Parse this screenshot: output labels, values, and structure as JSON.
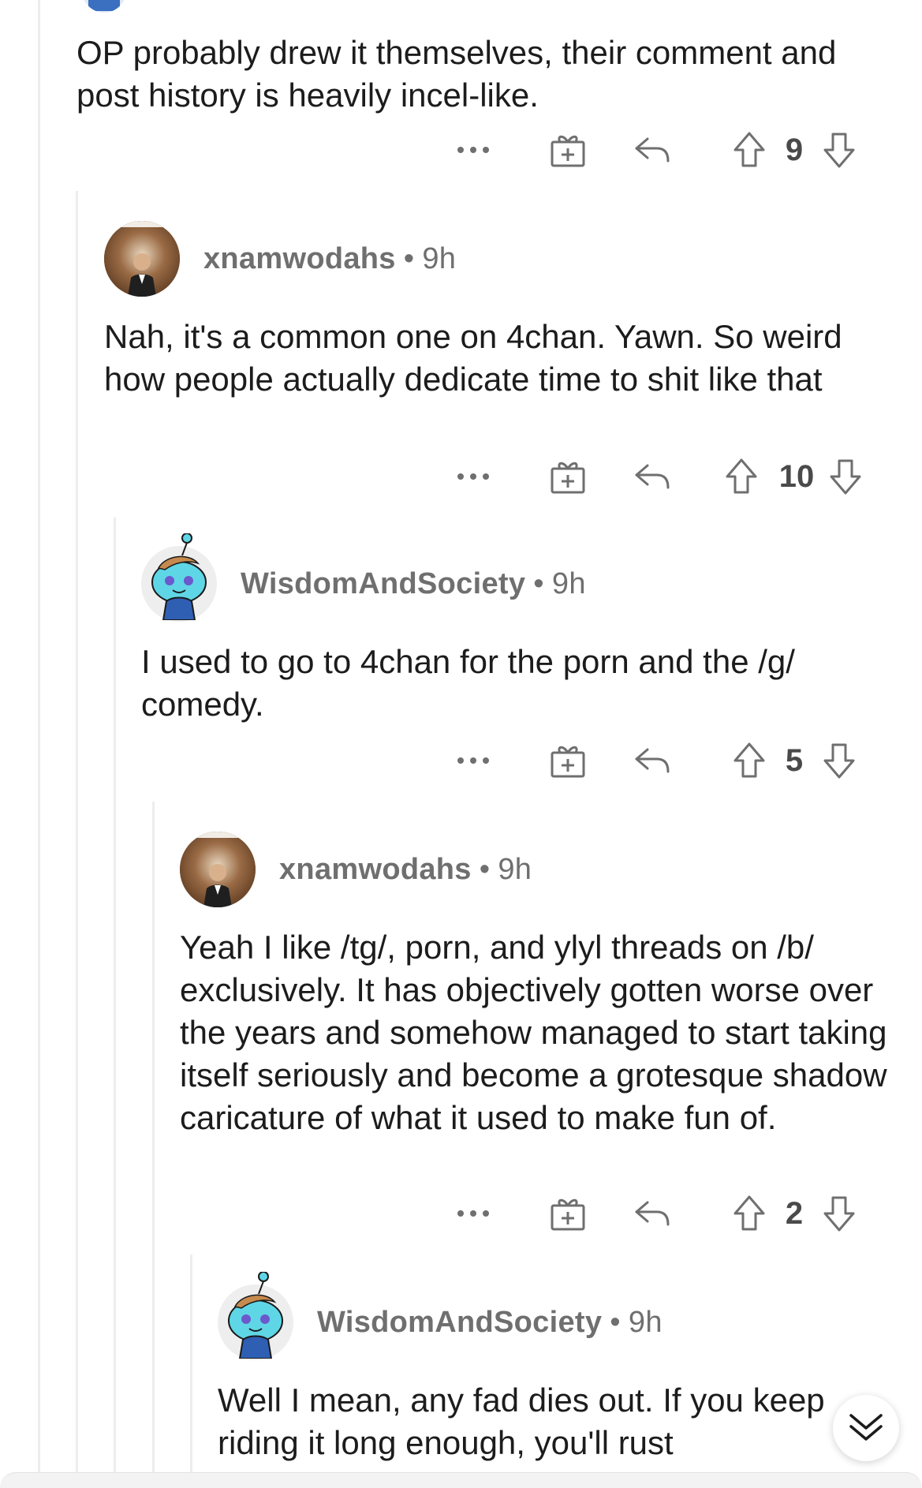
{
  "colors": {
    "text": "#1c1c1c",
    "meta": "#6f6f6f",
    "icon": "#6f6f6f",
    "thread_line": "#ededed"
  },
  "top_comment": {
    "text": "OP probably drew it themselves, their comment and post history is heavily incel-like.",
    "score": "9"
  },
  "comments": [
    {
      "username": "xnamwodahs",
      "separator": "•",
      "time": "9h",
      "avatar": "photo-avatar",
      "text": "Nah, it's a common one on 4chan. Yawn. So weird how people actually dedicate time to shit like that",
      "score": "10"
    },
    {
      "username": "WisdomAndSociety",
      "separator": "•",
      "time": "9h",
      "avatar": "snoo-avatar",
      "text": "I used to go to 4chan for the porn and the /g/ comedy.",
      "score": "5"
    },
    {
      "username": "xnamwodahs",
      "separator": "•",
      "time": "9h",
      "avatar": "photo-avatar",
      "text": "Yeah I like /tg/, porn, and ylyl threads on /b/ exclusively. It has objectively gotten worse over the years and somehow managed to start taking itself seriously and become a grotesque shadow caricature of what it used to make fun of.",
      "score": "2"
    },
    {
      "username": "WisdomAndSociety",
      "separator": "•",
      "time": "9h",
      "avatar": "snoo-avatar",
      "text": "Well I mean, any fad dies out. If you keep riding it long enough, you'll rust"
    }
  ],
  "icons": {
    "more": "more-options-icon",
    "award": "award-icon",
    "reply": "reply-icon",
    "upvote": "upvote-icon",
    "downvote": "downvote-icon",
    "collapse": "chevron-double-down-icon"
  }
}
